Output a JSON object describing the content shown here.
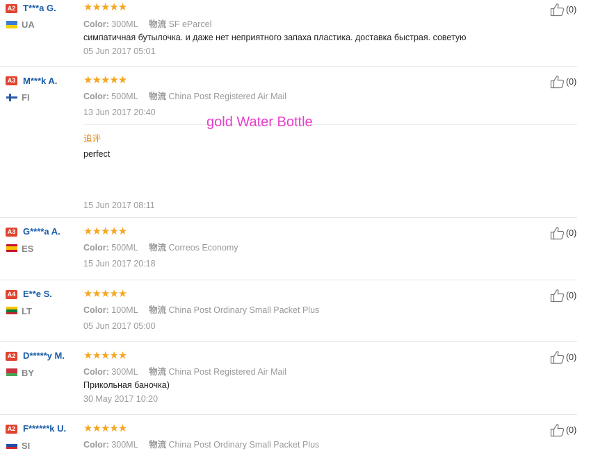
{
  "labels": {
    "color": "Color:",
    "shipping": "物流",
    "followup": "追评",
    "like_count": "(0)"
  },
  "watermark": "gold Water Bottle",
  "colors": {
    "username": "#1a5ca8",
    "star": "#f5a623",
    "badge": "#e0432e",
    "followup": "#e08a18",
    "watermark": "#e83fcb"
  },
  "reviews": [
    {
      "level": "A2",
      "name": "T***a G.",
      "country": "UA",
      "stars": "★★★★★",
      "rating": 5,
      "color": "300ML",
      "shipping": "SF eParcel",
      "text": "симпатичная бутылочка. и даже нет неприятного запаха пластика. доставка быстрая. советую",
      "date": "05 Jun 2017 05:01",
      "likes": "(0)"
    },
    {
      "level": "A3",
      "name": "M***k A.",
      "country": "FI",
      "stars": "★★★★★",
      "rating": 5,
      "color": "500ML",
      "shipping": "China Post Registered Air Mail",
      "text": "",
      "date": "13 Jun 2017 20:40",
      "followup_text": "perfect",
      "followup_date": "15 Jun 2017 08:11",
      "likes": "(0)"
    },
    {
      "level": "A3",
      "name": "G****a A.",
      "country": "ES",
      "stars": "★★★★★",
      "rating": 5,
      "color": "500ML",
      "shipping": "Correos Economy",
      "text": "",
      "date": "15 Jun 2017 20:18",
      "likes": "(0)"
    },
    {
      "level": "A4",
      "name": "E**e S.",
      "country": "LT",
      "stars": "★★★★★",
      "rating": 5,
      "color": "100ML",
      "shipping": "China Post Ordinary Small Packet Plus",
      "text": "",
      "date": "05 Jun 2017 05:00",
      "likes": "(0)"
    },
    {
      "level": "A2",
      "name": "D*****y M.",
      "country": "BY",
      "stars": "★★★★★",
      "rating": 5,
      "color": "300ML",
      "shipping": "China Post Registered Air Mail",
      "text": "Прикольная баночка)",
      "date": "30 May 2017 10:20",
      "likes": "(0)"
    },
    {
      "level": "A2",
      "name": "F******k U.",
      "country": "SI",
      "stars": "★★★★★",
      "rating": 5,
      "color": "300ML",
      "shipping": "China Post Ordinary Small Packet Plus",
      "text": "",
      "date": "",
      "likes": "(0)"
    }
  ]
}
